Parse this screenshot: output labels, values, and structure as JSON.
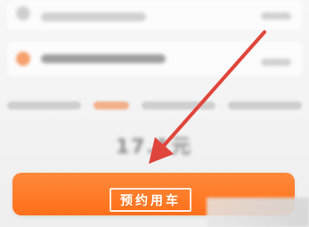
{
  "cta": {
    "label": "预约用车"
  },
  "price": {
    "text": "17.1元"
  },
  "colors": {
    "accent_orange": "#ff7a26",
    "annotation_red": "#e0443a"
  },
  "annotation": {
    "icon": "arrow-icon"
  }
}
